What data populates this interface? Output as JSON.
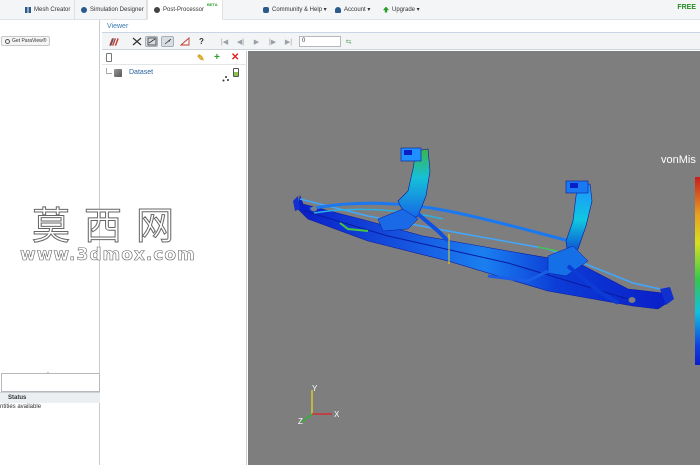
{
  "topbar": {
    "tabs": [
      {
        "label": "Mesh Creator",
        "icon": "grid-icon"
      },
      {
        "label": "Simulation Designer",
        "icon": "wrench-icon"
      },
      {
        "label": "Post-Processor",
        "icon": "circle-icon",
        "badge": "BETA",
        "active": true
      }
    ],
    "nav": [
      {
        "label": "Community & Help ▾",
        "icon": "people-icon"
      },
      {
        "label": "Account ▾",
        "icon": "user-icon"
      },
      {
        "label": "Upgrade ▾",
        "icon": "upgrade-icon"
      }
    ],
    "plan": "FREE"
  },
  "left": {
    "get_paraview": "Get ParaView®",
    "status_header": "Status",
    "status_message": "ntities available"
  },
  "viewer": {
    "title": "Viewer",
    "frame_value": "0",
    "pipeline": {
      "dataset_label": "Dataset"
    },
    "legend_title": "vonMis",
    "axes": {
      "y": "Y",
      "x": "X",
      "z": "Z"
    }
  },
  "watermark": {
    "line1": "莫西网",
    "line2": "www.3dmox.com"
  },
  "colors": {
    "viewport_bg": "#7e7e7e",
    "accent_blue": "#3b78b0",
    "free_green": "#2a8a2a"
  }
}
